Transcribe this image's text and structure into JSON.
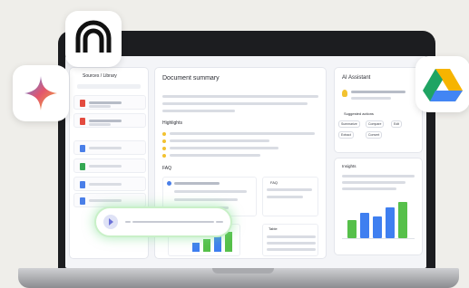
{
  "sources": {
    "title": "Sources / Library",
    "icon_colors": [
      "#e34b3f",
      "#e34b3f",
      "#4a7fe8",
      "#34a853",
      "#4a7fe8",
      "#4a7fe8"
    ]
  },
  "summary": {
    "title": "Document summary",
    "highlights_heading": "Highlights",
    "faq_heading": "FAQ",
    "faq_side_label": "FAQ"
  },
  "assistant": {
    "title": "AI Assistant",
    "suggestions_label": "Suggested actions",
    "actions": [
      "Summarize",
      "Compare",
      "Edit",
      "Extract",
      "Convert"
    ]
  },
  "insights": {
    "title": "Insights"
  },
  "table": {
    "title": "Table"
  },
  "colors": {
    "accent_blue": "#3f7ff0",
    "accent_green": "#56c04a",
    "glow_green": "#8fe39a"
  },
  "floating_icons": [
    "arch-logo-icon",
    "gemini-sparkle-icon",
    "google-drive-icon"
  ]
}
